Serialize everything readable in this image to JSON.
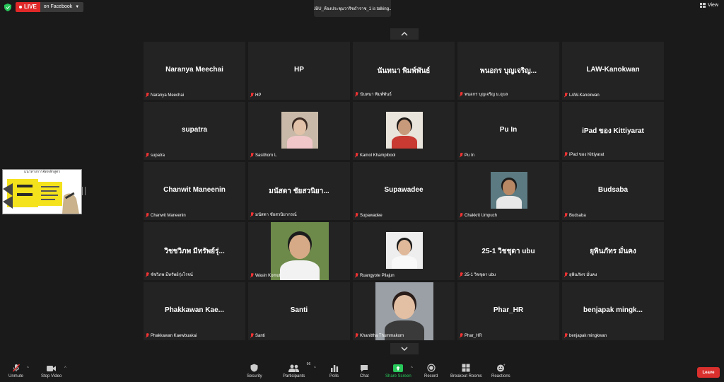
{
  "header": {
    "live_label": "LIVE",
    "stream_target": "on Facebook",
    "talking": "UBU_ห้องประชุมวาริชธำราช_1 is  talking...",
    "view_label": "View"
  },
  "tiles": [
    {
      "big": "Naranya Meechai",
      "small": "Naranya Meechai"
    },
    {
      "big": "HP",
      "small": "HP"
    },
    {
      "big": "นันทนา  พิมพ์พันธ์",
      "small": "นันทนา  พิมพ์พันธ์"
    },
    {
      "big": "พนอกร บุญเจริญ...",
      "small": "พนอกร บุญเจริญ ม.อุบล"
    },
    {
      "big": "LAW-Kanokwan",
      "small": "LAW-Kanokwan"
    },
    {
      "big": "supatra",
      "small": "supatra"
    },
    {
      "big": "",
      "small": "Sasithorn L"
    },
    {
      "big": "",
      "small": "Kamol Khampibool"
    },
    {
      "big": "Pu In",
      "small": "Pu In"
    },
    {
      "big": "iPad ของ Kittiyarat",
      "small": "iPad ของ Kittiyarat"
    },
    {
      "big": "Chanwit Maneenin",
      "small": "Chanwit Maneenin"
    },
    {
      "big": "มนัสดา ชัยสวนิยา...",
      "small": "มนัสดา ชัยสวนิยากรณ์"
    },
    {
      "big": "Supawadee",
      "small": "Supawadee"
    },
    {
      "big": "",
      "small": "Chakkrit Umpuch"
    },
    {
      "big": "Budsaba",
      "small": "Budsaba"
    },
    {
      "big": "วิชชวิภพ มีทรัพย์รุ่...",
      "small": "ชัชวิภพ มีทรัพย์รุ่งโรจน์"
    },
    {
      "big": "",
      "small": "Wasin Komut"
    },
    {
      "big": "",
      "small": "Ruangyote Pilajun"
    },
    {
      "big": "25-1 วิชชุดา ubu",
      "small": "25-1 วิชชุดา ubu"
    },
    {
      "big": "ยุพินภัทร มั่นคง",
      "small": "ยุพินภัทร มั่นคง"
    },
    {
      "big": "Phakkawan  Kae...",
      "small": "Phakkawan Kaewbuakai"
    },
    {
      "big": "Santi",
      "small": "Santi"
    },
    {
      "big": "",
      "small": "Khanittha Thummakorn"
    },
    {
      "big": "Phar_HR",
      "small": "Phar_HR"
    },
    {
      "big": "benjapak  mingk...",
      "small": "benjapak mingkwan"
    }
  ],
  "share": {
    "title": "แนวทางการจัดหลักสูตร"
  },
  "toolbar": {
    "unmute": "Unmute",
    "stop_video": "Stop Video",
    "security": "Security",
    "participants": "Participants",
    "participant_count": "96",
    "polls": "Polls",
    "chat": "Chat",
    "share_screen": "Share Screen",
    "record": "Record",
    "breakout_rooms": "Breakout Rooms",
    "reactions": "Reactions",
    "leave": "Leave"
  },
  "colors": {
    "live": "#e02828",
    "leave": "#d9302d",
    "share_screen": "#28c85a",
    "muted": "#e33333"
  }
}
